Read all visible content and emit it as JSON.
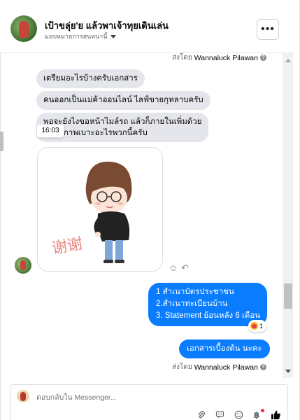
{
  "header": {
    "title": "เป้าขลุ่ย'ย แล้วพาเจ้าทุยเดินเล่น",
    "subtitle": "มอบหมายการสนทนานี้",
    "more_label": "•••",
    "avatar_icon": "profile-avatar"
  },
  "messages": {
    "sent_by_top": {
      "prefix": "ส่งโดย",
      "name": "Wannaluck Pilawan"
    },
    "incoming": [
      "เตรียมอะไรบ้างครับเอกสาร",
      "คนออกเป็นแม่ค้าออนไลน์ ไลฟ์ขายกุหลาบครับ",
      "พอจะยังไงขอหน้าไมล์รถ แล้วก็ภายในเพิ่มด้วย",
      "ครับสภาพเบาะอะไรพวกนี้ครับ"
    ],
    "timestamp_tooltip": "16:03",
    "sticker_caption": "谢谢",
    "outgoing_list": [
      "1 สำเนาบัตรประชาชน",
      "2.สำเนาทะเบียนบ้าน",
      "3. Statement ย้อนหลัง 6 เดือน"
    ],
    "reaction_count": "1",
    "outgoing_last": "เอกสารเบื้องต้น นะคะ",
    "sent_by_bottom": {
      "prefix": "ส่งโดย",
      "name": "Wannaluck Pilawan"
    }
  },
  "composer": {
    "placeholder": "ตอบกลับใน Messenger..."
  },
  "colors": {
    "outgoing_bubble": "#0a7cff",
    "incoming_bubble": "#e4e6eb",
    "like_icon": "#050505"
  }
}
